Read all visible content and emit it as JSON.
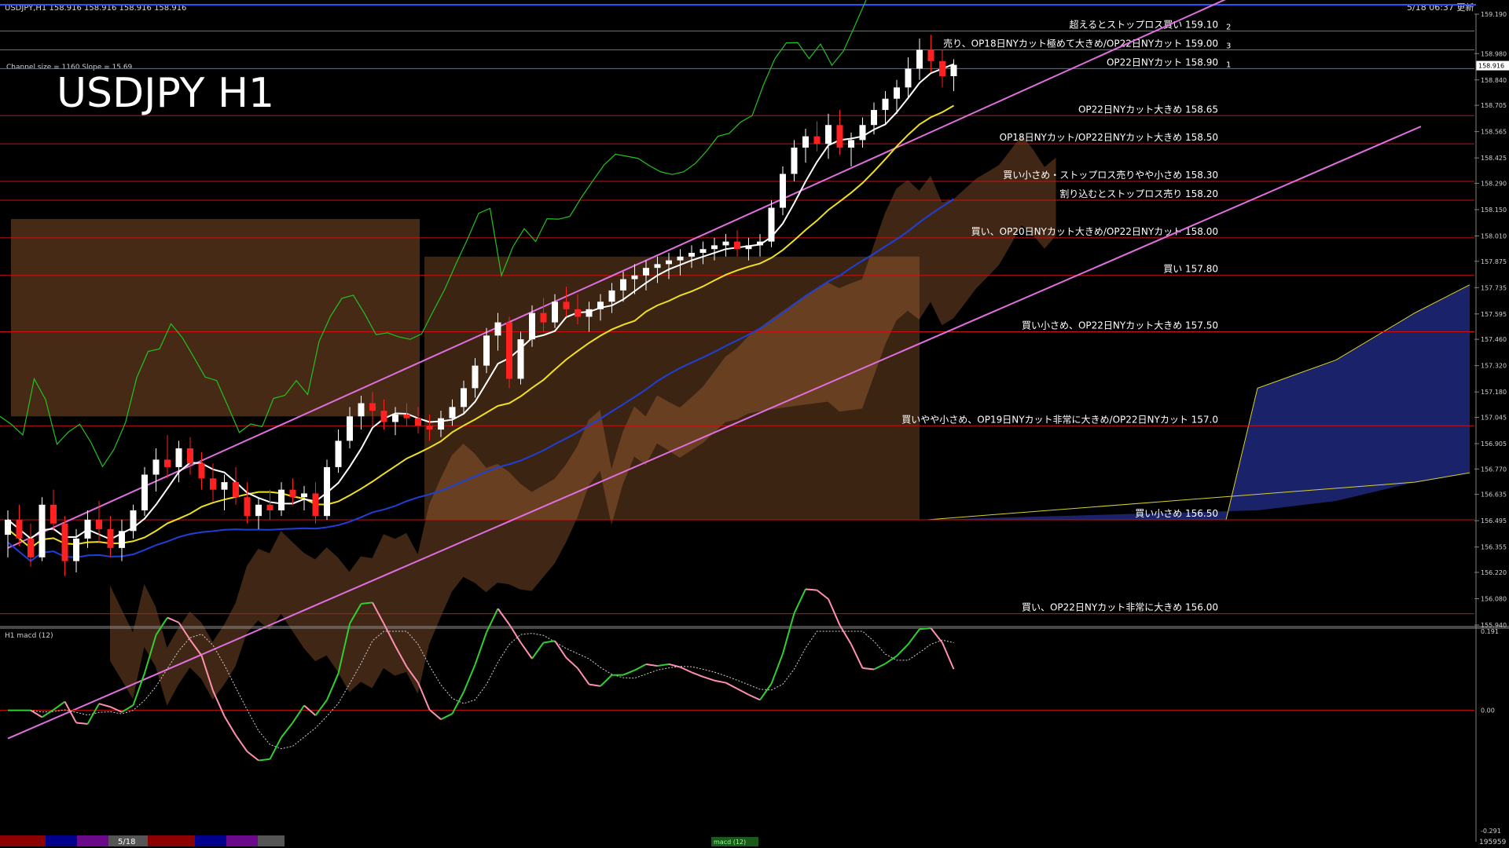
{
  "window": {
    "symbol_header": "USDJPY,H1  158.916 158.916 158.916 158.916",
    "datetime": "5/18 06:37 更新",
    "big_title": "USDJPY H1",
    "channel_info": "Channel size = 1160 Slope = 15.69"
  },
  "colors": {
    "background": "#000000",
    "level_line": "#cc1010",
    "top_level_line": "#3a7bd5",
    "channel": "#e070e0",
    "chikou": "#22c322",
    "sma_fast": "#ffffff",
    "sma_mid": "#f0e020",
    "sma_slow": "#1f3fd8",
    "bull_candle": "#ffffff",
    "bear_candle": "#ff2020",
    "kumo_bull": "#c87840",
    "kumo_bear": "#3040c0",
    "macd_up": "#30d030",
    "macd_down": "#ff90b0",
    "axis_text": "#d0d0d0"
  },
  "chart_data": [
    {
      "type": "line",
      "title": "USDJPY H1",
      "series_kind": "candlestick with Ichimoku, SMAs, channel",
      "ylim": [
        155.94,
        159.19
      ],
      "y_ticks": [
        159.19,
        158.98,
        158.84,
        158.705,
        158.565,
        158.425,
        158.29,
        158.15,
        158.01,
        157.875,
        157.735,
        157.595,
        157.46,
        157.32,
        157.18,
        157.045,
        156.905,
        156.77,
        156.635,
        156.495,
        156.355,
        156.22,
        156.08,
        155.94
      ],
      "y_tick_labels": [
        "159.190",
        "158.980",
        "158.840",
        "158.705",
        "158.565",
        "158.425",
        "158.290",
        "158.150",
        "158.010",
        "157.875",
        "157.735",
        "157.595",
        "157.460",
        "157.320",
        "157.180",
        "157.045",
        "156.905",
        "156.770",
        "156.635",
        "156.495",
        "156.355",
        "156.220",
        "156.080",
        "155.940"
      ],
      "current_price": 158.916,
      "current_price_label": "158.916",
      "levels": [
        {
          "price": 159.1,
          "text": "超えるとストップロス買い 159.10",
          "note": "2"
        },
        {
          "price": 159.0,
          "text": "売り、OP18日NYカット極めて大きめ/OP22日NYカット 159.00",
          "note": "3"
        },
        {
          "price": 158.9,
          "text": "OP22日NYカット 158.90",
          "note": "1"
        },
        {
          "price": 158.65,
          "text": "OP22日NYカット大きめ 158.65",
          "note": ""
        },
        {
          "price": 158.5,
          "text": "OP18日NYカット/OP22日NYカット大きめ 158.50",
          "note": ""
        },
        {
          "price": 158.3,
          "text": "買い小さめ・ストップロス売りやや小さめ 158.30",
          "note": ""
        },
        {
          "price": 158.2,
          "text": "割り込むとストップロス売り 158.20",
          "note": ""
        },
        {
          "price": 158.0,
          "text": "買い、OP20日NYカット大きめ/OP22日NYカット 158.00",
          "note": ""
        },
        {
          "price": 157.8,
          "text": "買い 157.80",
          "note": ""
        },
        {
          "price": 157.5,
          "text": "買い小さめ、OP22日NYカット大きめ 157.50",
          "note": ""
        },
        {
          "price": 157.0,
          "text": "買いやや小さめ、OP19日NYカット非常に大きめ/OP22日NYカット 157.0",
          "note": ""
        },
        {
          "price": 156.5,
          "text": "買い小さめ 156.50",
          "note": ""
        },
        {
          "price": 156.0,
          "text": "買い、OP22日NYカット非常に大きめ 156.00",
          "note": ""
        }
      ],
      "channel": {
        "upper": [
          [
            0,
            156.35
          ],
          [
            108,
            159.3
          ]
        ],
        "lower": [
          [
            23,
            155.94
          ],
          [
            130,
            158.75
          ]
        ]
      },
      "candles": [
        [
          156.42,
          156.55,
          156.3,
          156.5
        ],
        [
          156.5,
          156.58,
          156.36,
          156.4
        ],
        [
          156.4,
          156.48,
          156.25,
          156.3
        ],
        [
          156.3,
          156.62,
          156.28,
          156.58
        ],
        [
          156.58,
          156.66,
          156.44,
          156.48
        ],
        [
          156.48,
          156.52,
          156.2,
          156.28
        ],
        [
          156.28,
          156.45,
          156.22,
          156.4
        ],
        [
          156.4,
          156.55,
          156.35,
          156.5
        ],
        [
          156.5,
          156.6,
          156.38,
          156.45
        ],
        [
          156.45,
          156.52,
          156.3,
          156.35
        ],
        [
          156.35,
          156.5,
          156.28,
          156.44
        ],
        [
          156.44,
          156.58,
          156.4,
          156.55
        ],
        [
          156.55,
          156.78,
          156.52,
          156.74
        ],
        [
          156.74,
          156.88,
          156.65,
          156.82
        ],
        [
          156.82,
          156.95,
          156.72,
          156.78
        ],
        [
          156.78,
          156.92,
          156.7,
          156.88
        ],
        [
          156.88,
          156.94,
          156.74,
          156.8
        ],
        [
          156.8,
          156.86,
          156.66,
          156.72
        ],
        [
          156.72,
          156.8,
          156.6,
          156.66
        ],
        [
          156.66,
          156.74,
          156.55,
          156.7
        ],
        [
          156.7,
          156.78,
          156.58,
          156.62
        ],
        [
          156.62,
          156.7,
          156.48,
          156.52
        ],
        [
          156.52,
          156.62,
          156.45,
          156.58
        ],
        [
          156.58,
          156.66,
          156.5,
          156.55
        ],
        [
          156.55,
          156.7,
          156.52,
          156.66
        ],
        [
          156.66,
          156.72,
          156.58,
          156.62
        ],
        [
          156.62,
          156.68,
          156.55,
          156.64
        ],
        [
          156.64,
          156.7,
          156.48,
          156.52
        ],
        [
          156.52,
          156.82,
          156.5,
          156.78
        ],
        [
          156.78,
          156.98,
          156.75,
          156.92
        ],
        [
          156.92,
          157.1,
          156.88,
          157.05
        ],
        [
          157.05,
          157.16,
          156.98,
          157.12
        ],
        [
          157.12,
          157.18,
          157.0,
          157.08
        ],
        [
          157.08,
          157.14,
          156.98,
          157.02
        ],
        [
          157.02,
          157.1,
          156.95,
          157.06
        ],
        [
          157.06,
          157.12,
          157.0,
          157.04
        ],
        [
          157.04,
          157.1,
          156.96,
          157.0
        ],
        [
          157.0,
          157.06,
          156.92,
          156.98
        ],
        [
          156.98,
          157.08,
          156.94,
          157.04
        ],
        [
          157.04,
          157.14,
          157.0,
          157.1
        ],
        [
          157.1,
          157.24,
          157.06,
          157.2
        ],
        [
          157.2,
          157.36,
          157.15,
          157.32
        ],
        [
          157.32,
          157.52,
          157.28,
          157.48
        ],
        [
          157.48,
          157.6,
          157.4,
          157.55
        ],
        [
          157.55,
          157.58,
          157.2,
          157.25
        ],
        [
          157.25,
          157.5,
          157.22,
          157.46
        ],
        [
          157.46,
          157.64,
          157.42,
          157.6
        ],
        [
          157.6,
          157.68,
          157.5,
          157.55
        ],
        [
          157.55,
          157.7,
          157.52,
          157.66
        ],
        [
          157.66,
          157.74,
          157.58,
          157.62
        ],
        [
          157.62,
          157.7,
          157.54,
          157.58
        ],
        [
          157.58,
          157.66,
          157.5,
          157.62
        ],
        [
          157.62,
          157.7,
          157.56,
          157.66
        ],
        [
          157.66,
          157.76,
          157.6,
          157.72
        ],
        [
          157.72,
          157.82,
          157.66,
          157.78
        ],
        [
          157.78,
          157.86,
          157.7,
          157.8
        ],
        [
          157.8,
          157.88,
          157.72,
          157.84
        ],
        [
          157.84,
          157.9,
          157.76,
          157.86
        ],
        [
          157.86,
          157.92,
          157.78,
          157.88
        ],
        [
          157.88,
          157.94,
          157.8,
          157.9
        ],
        [
          157.9,
          157.96,
          157.84,
          157.92
        ],
        [
          157.92,
          157.98,
          157.86,
          157.94
        ],
        [
          157.94,
          158.0,
          157.88,
          157.96
        ],
        [
          157.96,
          158.02,
          157.9,
          157.98
        ],
        [
          157.98,
          158.04,
          157.9,
          157.94
        ],
        [
          157.94,
          158.0,
          157.88,
          157.96
        ],
        [
          157.96,
          158.02,
          157.9,
          157.98
        ],
        [
          157.98,
          158.2,
          157.95,
          158.16
        ],
        [
          158.16,
          158.38,
          158.12,
          158.34
        ],
        [
          158.34,
          158.52,
          158.3,
          158.48
        ],
        [
          158.48,
          158.58,
          158.4,
          158.54
        ],
        [
          158.54,
          158.62,
          158.46,
          158.5
        ],
        [
          158.5,
          158.66,
          158.42,
          158.6
        ],
        [
          158.6,
          158.68,
          158.44,
          158.48
        ],
        [
          158.48,
          158.56,
          158.38,
          158.52
        ],
        [
          158.52,
          158.64,
          158.48,
          158.6
        ],
        [
          158.6,
          158.72,
          158.55,
          158.68
        ],
        [
          158.68,
          158.78,
          158.6,
          158.74
        ],
        [
          158.74,
          158.84,
          158.66,
          158.8
        ],
        [
          158.8,
          158.96,
          158.74,
          158.9
        ],
        [
          158.9,
          159.06,
          158.84,
          159.0
        ],
        [
          159.0,
          159.08,
          158.88,
          158.94
        ],
        [
          158.94,
          159.0,
          158.8,
          158.86
        ],
        [
          158.86,
          158.95,
          158.78,
          158.92
        ]
      ],
      "macd": {
        "ylim": [
          -0.291,
          0.191
        ],
        "y_tick_labels": [
          "0.191",
          "0.00",
          "-0.291"
        ],
        "label": "H1  macd (12)"
      },
      "bottom_labels": {
        "date": "5/18",
        "macd_tag": "macd (12)",
        "right_value": "195959"
      }
    }
  ]
}
